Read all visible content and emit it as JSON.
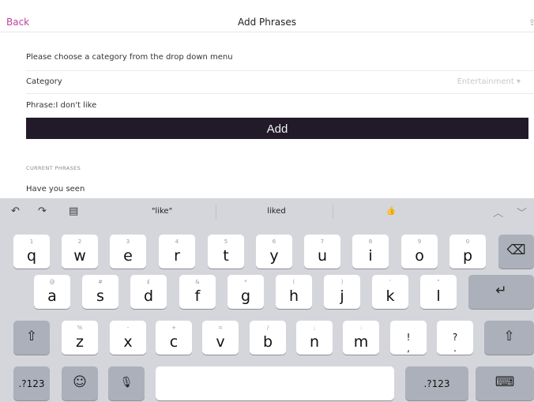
{
  "navbar": {
    "back": "Back",
    "title": "Add Phrases",
    "share_icon": "share-icon"
  },
  "form": {
    "instruction": "Please choose a category from the drop down menu",
    "category_label": "Category",
    "category_value": "Entertainment",
    "dropdown_icon": "▾",
    "phrase_label": "Phrase:",
    "phrase_value": "I don't like",
    "add_button": "Add"
  },
  "current": {
    "section_title": "CURRENT PHRASES",
    "items": [
      "Have you seen"
    ]
  },
  "keyboard": {
    "toolbar": {
      "undo": "↶",
      "redo": "↷",
      "paste": "▤",
      "chev_up": "︿",
      "chev_down": "﹀"
    },
    "suggestions": [
      "\"like\"",
      "liked",
      "👍"
    ],
    "row1": [
      {
        "sec": "1",
        "main": "q"
      },
      {
        "sec": "2",
        "main": "w"
      },
      {
        "sec": "3",
        "main": "e"
      },
      {
        "sec": "4",
        "main": "r"
      },
      {
        "sec": "5",
        "main": "t"
      },
      {
        "sec": "6",
        "main": "y"
      },
      {
        "sec": "7",
        "main": "u"
      },
      {
        "sec": "8",
        "main": "i"
      },
      {
        "sec": "9",
        "main": "o"
      },
      {
        "sec": "0",
        "main": "p"
      }
    ],
    "row2": [
      {
        "sec": "@",
        "main": "a"
      },
      {
        "sec": "#",
        "main": "s"
      },
      {
        "sec": "£",
        "main": "d"
      },
      {
        "sec": "&",
        "main": "f"
      },
      {
        "sec": "*",
        "main": "g"
      },
      {
        "sec": "(",
        "main": "h"
      },
      {
        "sec": ")",
        "main": "j"
      },
      {
        "sec": "'",
        "main": "k"
      },
      {
        "sec": "\"",
        "main": "l"
      }
    ],
    "row3": [
      {
        "sec": "%",
        "main": "z"
      },
      {
        "sec": "-",
        "main": "x"
      },
      {
        "sec": "+",
        "main": "c"
      },
      {
        "sec": "=",
        "main": "v"
      },
      {
        "sec": "/",
        "main": "b"
      },
      {
        "sec": ";",
        "main": "n"
      },
      {
        "sec": ":",
        "main": "m"
      },
      {
        "sec": "!",
        "main": ","
      },
      {
        "sec": "?",
        "main": "."
      }
    ],
    "special": {
      "backspace": "⌫",
      "return": "↵",
      "shift": "⇧",
      "numbers": ".?123",
      "emoji": "☺",
      "mic": "🎙",
      "numbers_right": ".?123",
      "hide": "⌨"
    }
  }
}
